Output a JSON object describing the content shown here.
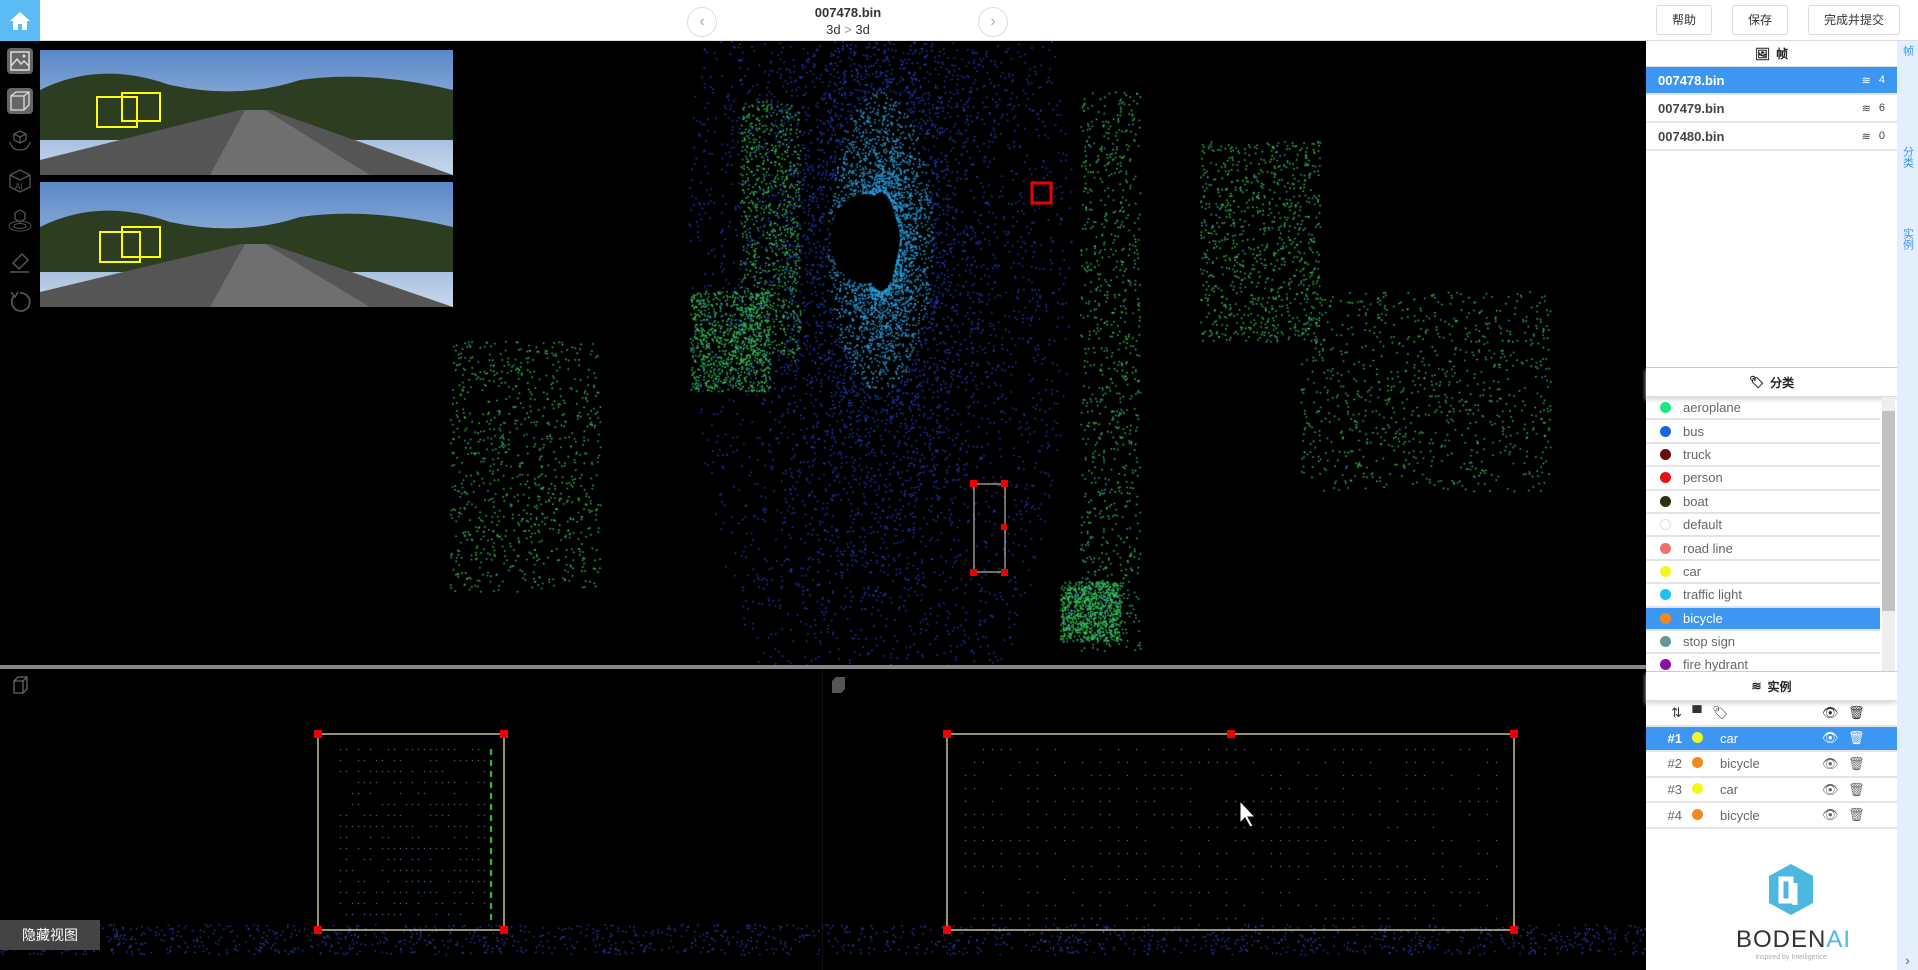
{
  "header": {
    "title": "007478.bin",
    "breadcrumb_from": "3d",
    "breadcrumb_sep": ">",
    "breadcrumb_to": "3d",
    "help": "帮助",
    "save": "保存",
    "submit": "完成并提交",
    "prev": "‹",
    "next": "›"
  },
  "toolbar": [
    "image-view",
    "cube-view",
    "rotate-cube",
    "ai-cube",
    "cube-radar",
    "eraser",
    "undo"
  ],
  "bottom": {
    "hide_view": "隐藏视图"
  },
  "frames": {
    "title": "帧",
    "items": [
      {
        "name": "007478.bin",
        "count": "4",
        "selected": true
      },
      {
        "name": "007479.bin",
        "count": "6"
      },
      {
        "name": "007480.bin",
        "count": "0"
      }
    ]
  },
  "classes": {
    "title": "分类",
    "items": [
      {
        "label": "aeroplane",
        "color": "#1de38a"
      },
      {
        "label": "bus",
        "color": "#1565e8"
      },
      {
        "label": "truck",
        "color": "#6b0a0a"
      },
      {
        "label": "person",
        "color": "#e81010"
      },
      {
        "label": "boat",
        "color": "#2f2f10"
      },
      {
        "label": "default",
        "color": "#ffffff"
      },
      {
        "label": "road line",
        "color": "#ee7070"
      },
      {
        "label": "car",
        "color": "#f5f520"
      },
      {
        "label": "traffic light",
        "color": "#1ec0f0"
      },
      {
        "label": "bicycle",
        "color": "#f08a20",
        "selected": true
      },
      {
        "label": "stop sign",
        "color": "#5f9a96"
      },
      {
        "label": "fire hydrant",
        "color": "#8a10a0"
      }
    ]
  },
  "instances": {
    "title": "实例",
    "items": [
      {
        "id": "#1",
        "label": "car",
        "color": "#f5f520",
        "selected": true
      },
      {
        "id": "#2",
        "label": "bicycle",
        "color": "#f08a20"
      },
      {
        "id": "#3",
        "label": "car",
        "color": "#f5f520"
      },
      {
        "id": "#4",
        "label": "bicycle",
        "color": "#f08a20"
      }
    ]
  },
  "side_tabs": [
    "帧",
    "分类",
    "实例"
  ],
  "logo": {
    "text": "BODENAI",
    "tagline": "Inspired by Intelligence"
  }
}
